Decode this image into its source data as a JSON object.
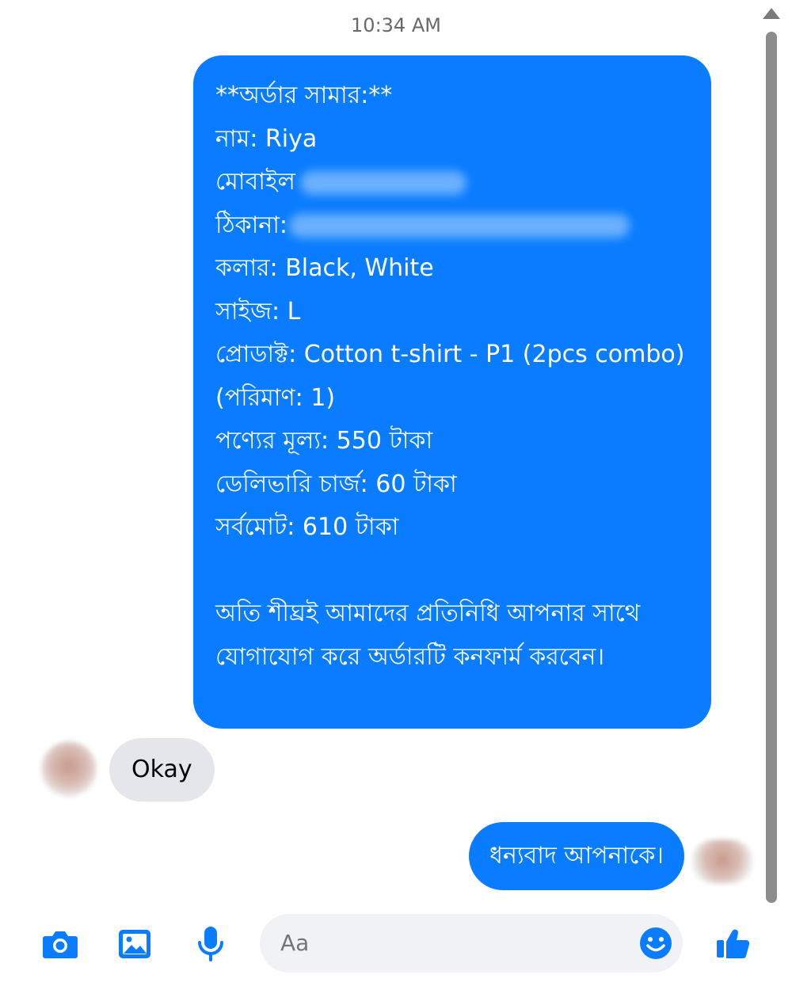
{
  "chat": {
    "timestamp": "10:34 AM",
    "order_message": {
      "heading": "**অর্ডার সামার:**",
      "name_label": "নাম:",
      "name_value": "Riya",
      "mobile_label": "মোবাইল",
      "address_label": "ঠিকানা:",
      "color_line": "কলার: Black, White",
      "size_line": "সাইজ: L",
      "product_line": "প্রোডাক্ট: Cotton t-shirt - P1 (2pcs combo) (পরিমাণ: 1)",
      "price_line": "পণ্যের মূল্য: 550 টাকা",
      "delivery_line": "ডেলিভারি চার্জ: 60 টাকা",
      "total_line": "সর্বমোট: 610 টাকা",
      "note": "অতি শীঘ্রই আমাদের প্রতিনিধি আপনার সাথে যোগাযোগ করে অর্ডারটি কনফার্ম করবেন।"
    },
    "incoming_reply": "Okay",
    "outgoing_reply": "ধন্যবাদ আপনাকে।"
  },
  "composer": {
    "placeholder": "Aa",
    "icons": [
      "camera-icon",
      "image-icon",
      "microphone-icon",
      "emoji-icon",
      "like-icon"
    ]
  },
  "colors": {
    "outgoing_bubble": "#0a7cff",
    "incoming_bubble": "#e4e6eb",
    "accent": "#0a7cff"
  }
}
